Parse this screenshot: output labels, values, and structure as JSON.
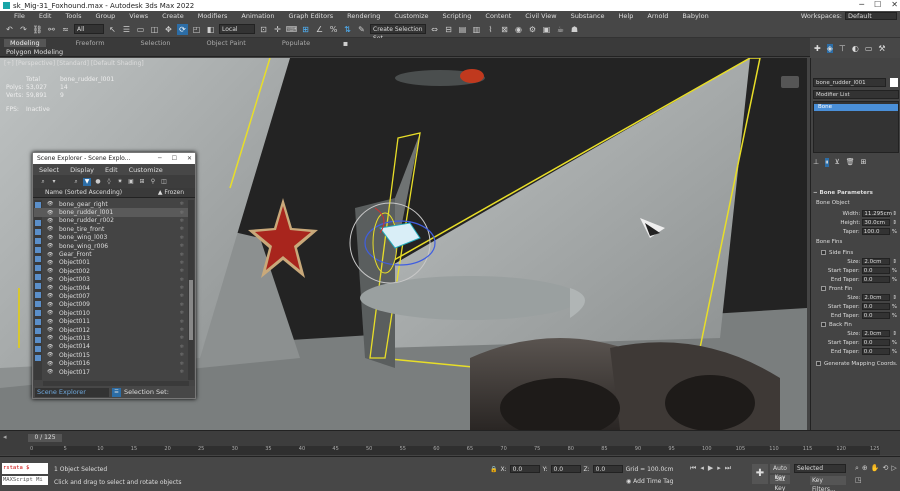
{
  "window": {
    "title": "sk_Mig-31_Foxhound.max - Autodesk 3ds Max 2022"
  },
  "menu": [
    "File",
    "Edit",
    "Tools",
    "Group",
    "Views",
    "Create",
    "Modifiers",
    "Animation",
    "Graph Editors",
    "Rendering",
    "Customize",
    "Scripting",
    "Content",
    "Civil View",
    "Substance",
    "Help",
    "Arnold",
    "Babylon"
  ],
  "workspace": {
    "label": "Workspaces:",
    "value": "Default"
  },
  "toolbar": {
    "filter": "All",
    "coord": "Local",
    "selset": "Create Selection Set"
  },
  "ribbon": {
    "tabs": [
      "Modeling",
      "Freeform",
      "Selection",
      "Object Paint",
      "Populate"
    ],
    "active": "Modeling",
    "sub": "Polygon Modeling"
  },
  "viewport": {
    "label": "[+] [Perspective] [Standard] [Default Shading]",
    "stats": {
      "header": [
        "",
        "Total",
        "bone_rudder_l001"
      ],
      "polys": [
        "Polys:",
        "53,027",
        "14"
      ],
      "verts": [
        "Verts:",
        "59,891",
        "9"
      ],
      "fps": [
        "FPS:",
        "Inactive"
      ]
    }
  },
  "scene_explorer": {
    "title": "Scene Explorer - Scene Explo...",
    "menu": [
      "Select",
      "Display",
      "Edit",
      "Customize"
    ],
    "column": "Name (Sorted Ascending)",
    "frozen": "▲ Frozen",
    "items": [
      "bone_gear_right",
      "bone_rudder_l001",
      "bone_rudder_r002",
      "bone_tire_front",
      "bone_wing_l003",
      "bone_wing_r006",
      "Gear_Front",
      "Object001",
      "Object002",
      "Object003",
      "Object004",
      "Object007",
      "Object009",
      "Object010",
      "Object011",
      "Object012",
      "Object013",
      "Object014",
      "Object015",
      "Object016",
      "Object017"
    ],
    "selected_index": 1,
    "footer_dd": "Scene Explorer",
    "footer_sel": "Selection Set:"
  },
  "command_panel": {
    "object_name": "bone_rudder_l001",
    "modifier_list": "Modifier List",
    "stack_item": "Bone",
    "rollout": "Bone Parameters",
    "bone_object": "Bone Object",
    "width": {
      "label": "Width:",
      "value": "11.295cm"
    },
    "height": {
      "label": "Height:",
      "value": "30.0cm"
    },
    "taper": {
      "label": "Taper:",
      "value": "100.0",
      "unit": "%"
    },
    "bone_fins": "Bone Fins",
    "side_fins": "Side Fins",
    "front_fin": "Front Fin",
    "back_fin": "Back Fin",
    "size_label": "Size:",
    "start_taper_label": "Start Taper:",
    "end_taper_label": "End Taper:",
    "size_value": "2.0cm",
    "taper_value": "0.0",
    "size_value_front": "2.0cm",
    "gen_mapping": "Generate Mapping Coords."
  },
  "timeline": {
    "slider": "0 / 125",
    "ticks": [
      "0",
      "5",
      "10",
      "15",
      "20",
      "25",
      "30",
      "35",
      "40",
      "45",
      "50",
      "55",
      "60",
      "65",
      "70",
      "75",
      "80",
      "85",
      "90",
      "95",
      "100",
      "105",
      "110",
      "115",
      "120",
      "125"
    ]
  },
  "status": {
    "maxscript_top": "rstata $ (mig)",
    "maxscript_bottom": "MAXScript Mi",
    "line1": "1 Object Selected",
    "line2": "Click and drag to select and rotate objects",
    "x_label": "X:",
    "x": "0.0",
    "y_label": "Y:",
    "y": "0.0",
    "z_label": "Z:",
    "z": "0.0",
    "grid": "Grid = 100.0cm",
    "add_time_tag": "Add Time Tag",
    "auto_key": "Auto Key",
    "set_key": "Set Key",
    "selected": "Selected",
    "key_filters": "Key Filters..."
  }
}
